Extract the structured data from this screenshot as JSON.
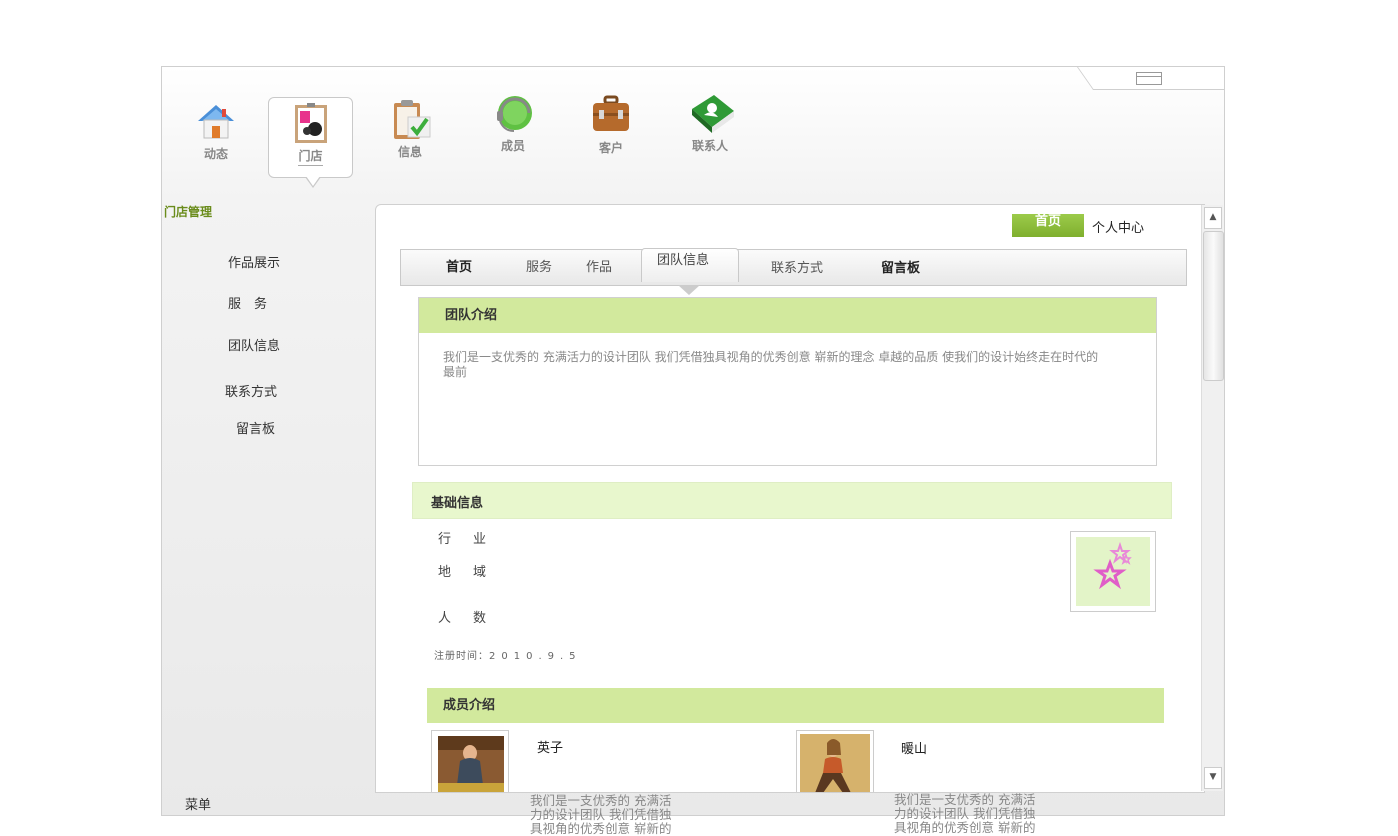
{
  "nav": [
    {
      "label": "动态",
      "icon": "house-icon"
    },
    {
      "label": "门店",
      "icon": "store-icon"
    },
    {
      "label": "信息",
      "icon": "clipboard-check-icon"
    },
    {
      "label": "成员",
      "icon": "headset-icon"
    },
    {
      "label": "客户",
      "icon": "briefcase-icon"
    },
    {
      "label": "联系人",
      "icon": "address-book-icon"
    }
  ],
  "sidebar": {
    "title": "门店管理",
    "items": [
      "作品展示",
      "服　务",
      "团队信息",
      "联系方式",
      "留言板"
    ],
    "menu_label": "菜单"
  },
  "header": {
    "home": "首页",
    "personal": "个人中心"
  },
  "tabs": [
    "首页",
    "服务",
    "作品",
    "团队信息",
    "联系方式",
    "留言板"
  ],
  "team": {
    "title": "团队介绍",
    "text": "我们是一支优秀的 充满活力的设计团队 我们凭借独具视角的优秀创意 崭新的理念 卓越的品质 使我们的设计始终走在时代的最前"
  },
  "basic": {
    "title": "基础信息",
    "fields": [
      "行业",
      "地域",
      "人数"
    ],
    "reg_label": "注册时间：",
    "reg_value": "2010.9.5",
    "avatar_icon": "stars-icon"
  },
  "members": {
    "title": "成员介绍",
    "items": [
      {
        "name": "英子",
        "desc": "我们是一支优秀的 充满活力的设计团队 我们凭借独具视角的优秀创意 崭新的"
      },
      {
        "name": "暖山",
        "desc": "我们是一支优秀的 充满活力的设计团队 我们凭借独具视角的优秀创意 崭新的"
      }
    ]
  },
  "colors": {
    "accent_green": "#9ccb4a",
    "section_green": "#d2e99d",
    "light_green": "#e8f7cd"
  }
}
